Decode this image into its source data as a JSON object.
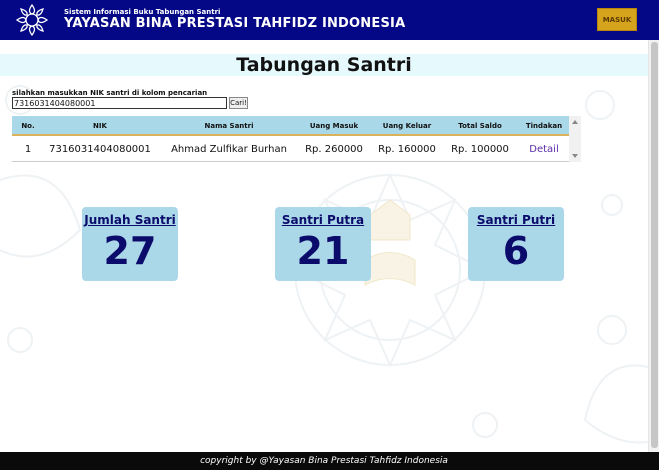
{
  "header": {
    "subtitle": "Sistem Informasi Buku Tabungan Santri",
    "title": "YAYASAN BINA PRESTASI TAHFIDZ INDONESIA",
    "login_label": "MASUK"
  },
  "page": {
    "title": "Tabungan Santri"
  },
  "search": {
    "label": "silahkan masukkan NIK santri di kolom pencarian",
    "value": "7316031404080001",
    "button_label": "Cari!"
  },
  "table": {
    "columns": [
      "No.",
      "NIK",
      "Nama Santri",
      "Uang Masuk",
      "Uang Keluar",
      "Total Saldo",
      "Tindakan"
    ],
    "rows": [
      {
        "no": "1",
        "nik": "7316031404080001",
        "nama": "Ahmad Zulfikar Burhan",
        "masuk": "Rp. 260000",
        "keluar": "Rp. 160000",
        "saldo": "Rp. 100000",
        "aksi": "Detail"
      }
    ]
  },
  "stats": [
    {
      "label": "Jumlah Santri",
      "value": "27"
    },
    {
      "label": "Santri Putra",
      "value": "21"
    },
    {
      "label": "Santri Putri",
      "value": "6"
    }
  ],
  "footer": {
    "text": "copyright by @Yayasan Bina Prestasi Tahfidz Indonesia"
  },
  "colors": {
    "header_bg": "#050886",
    "login_button": "#d6a31d",
    "title_band": "#e6fafd",
    "table_header": "#a9d8e8",
    "card_bg": "#abd8e8",
    "card_text": "#0b0b6b",
    "link": "#5b2ea6",
    "footer_bg": "#0a0a0a"
  }
}
